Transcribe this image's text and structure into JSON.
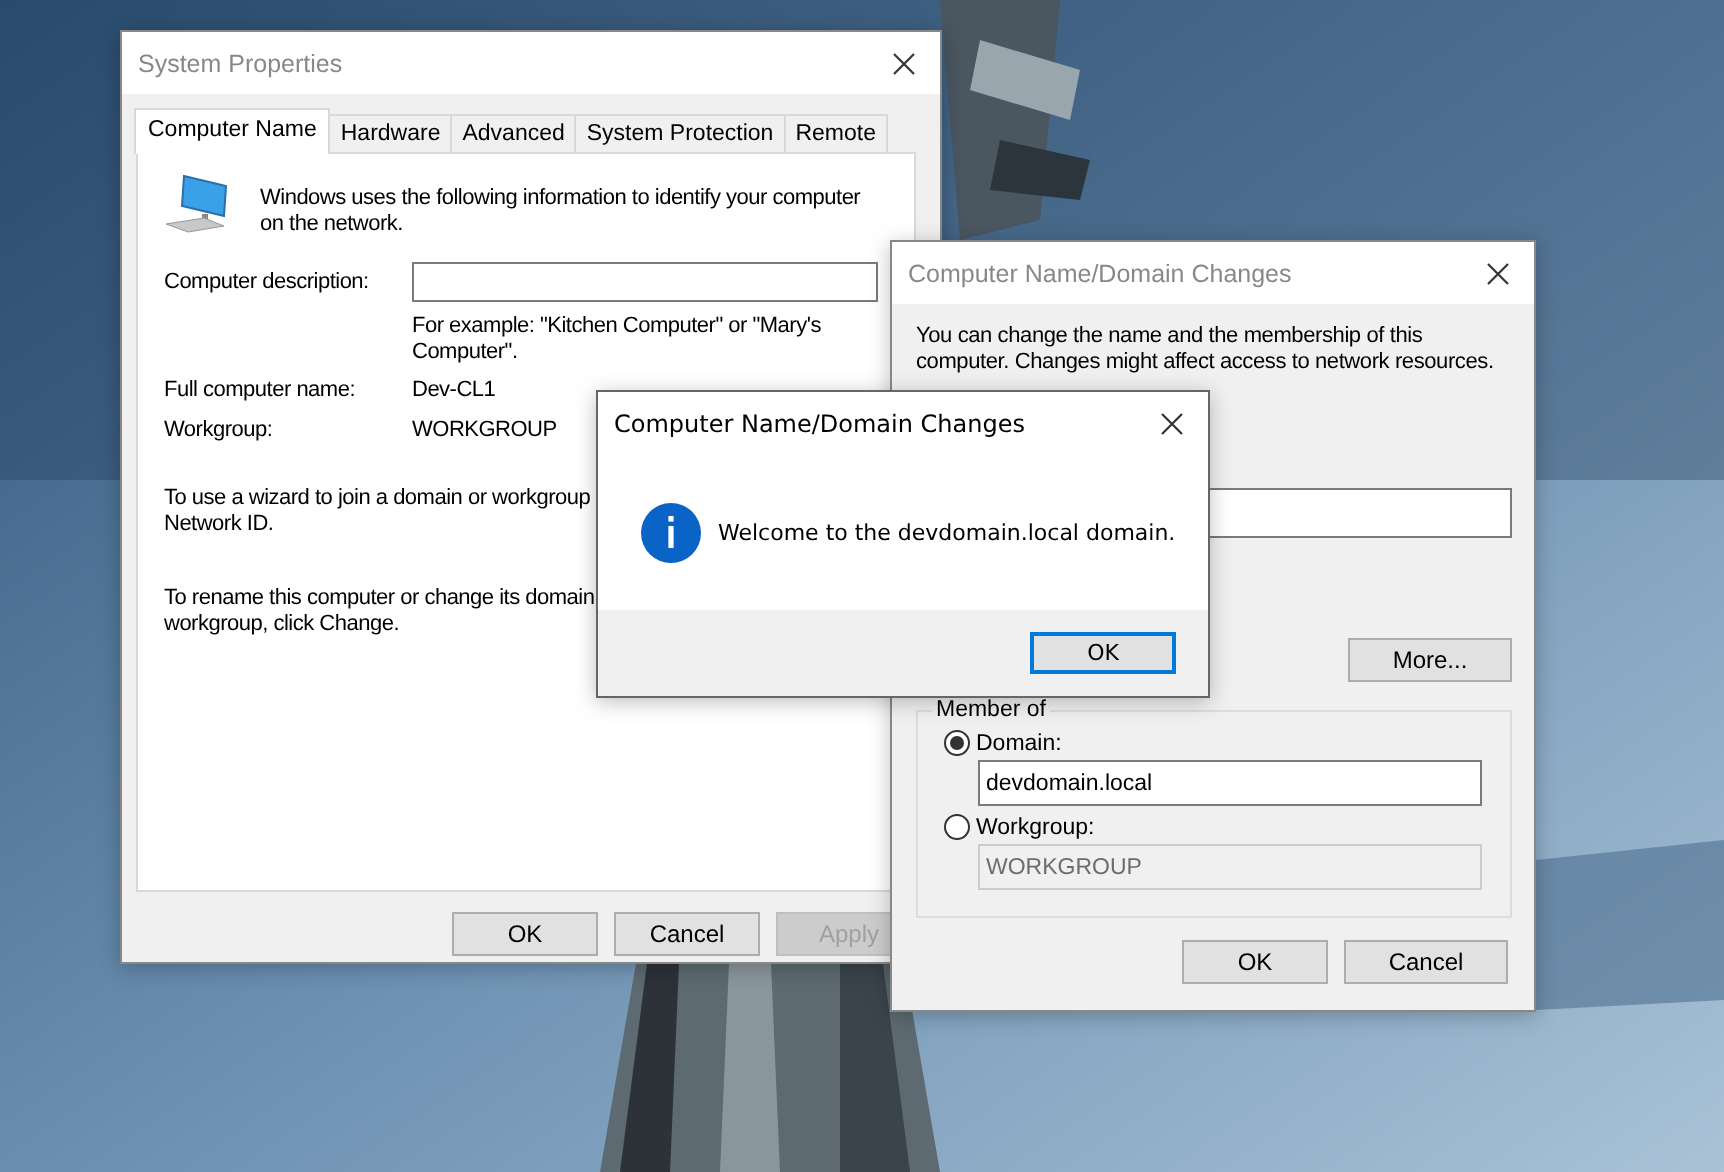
{
  "system_properties": {
    "title": "System Properties",
    "tabs": [
      {
        "label": "Computer Name",
        "selected": true
      },
      {
        "label": "Hardware",
        "selected": false
      },
      {
        "label": "Advanced",
        "selected": false
      },
      {
        "label": "System Protection",
        "selected": false
      },
      {
        "label": "Remote",
        "selected": false
      }
    ],
    "intro": "Windows uses the following information to identify your computer on the network.",
    "description_label": "Computer description:",
    "description_hint": "For example: \"Kitchen Computer\" or \"Mary's Computer\".",
    "full_name_label": "Full computer name:",
    "full_name": "Dev-CL1",
    "workgroup_label": "Workgroup:",
    "workgroup": "WORKGROUP",
    "network_id_text": "To use a wizard to join a domain or workgroup\nNetwork ID.",
    "rename_text": "To rename this computer or change its domain\nworkgroup, click Change.",
    "buttons": [
      {
        "label": "OK",
        "disabled": false
      },
      {
        "label": "Cancel",
        "disabled": false
      },
      {
        "label": "Apply",
        "disabled": true
      }
    ]
  },
  "domain_changes": {
    "title": "Computer Name/Domain Changes",
    "intro": "You can change the name and the membership of this computer. Changes might affect access to network resources.",
    "more_button": "More...",
    "member_of": {
      "legend": "Member of",
      "options": [
        {
          "label": "Domain:",
          "selected": true,
          "value": "devdomain.local",
          "disabled": false
        },
        {
          "label": "Workgroup:",
          "selected": false,
          "value": "WORKGROUP",
          "disabled": true
        }
      ]
    },
    "buttons": [
      {
        "label": "OK",
        "disabled": false
      },
      {
        "label": "Cancel",
        "disabled": false
      }
    ]
  },
  "message": {
    "title": "Computer Name/Domain Changes",
    "text": "Welcome to the devdomain.local domain.",
    "buttons": [
      {
        "label": "OK",
        "focused": true
      }
    ]
  }
}
